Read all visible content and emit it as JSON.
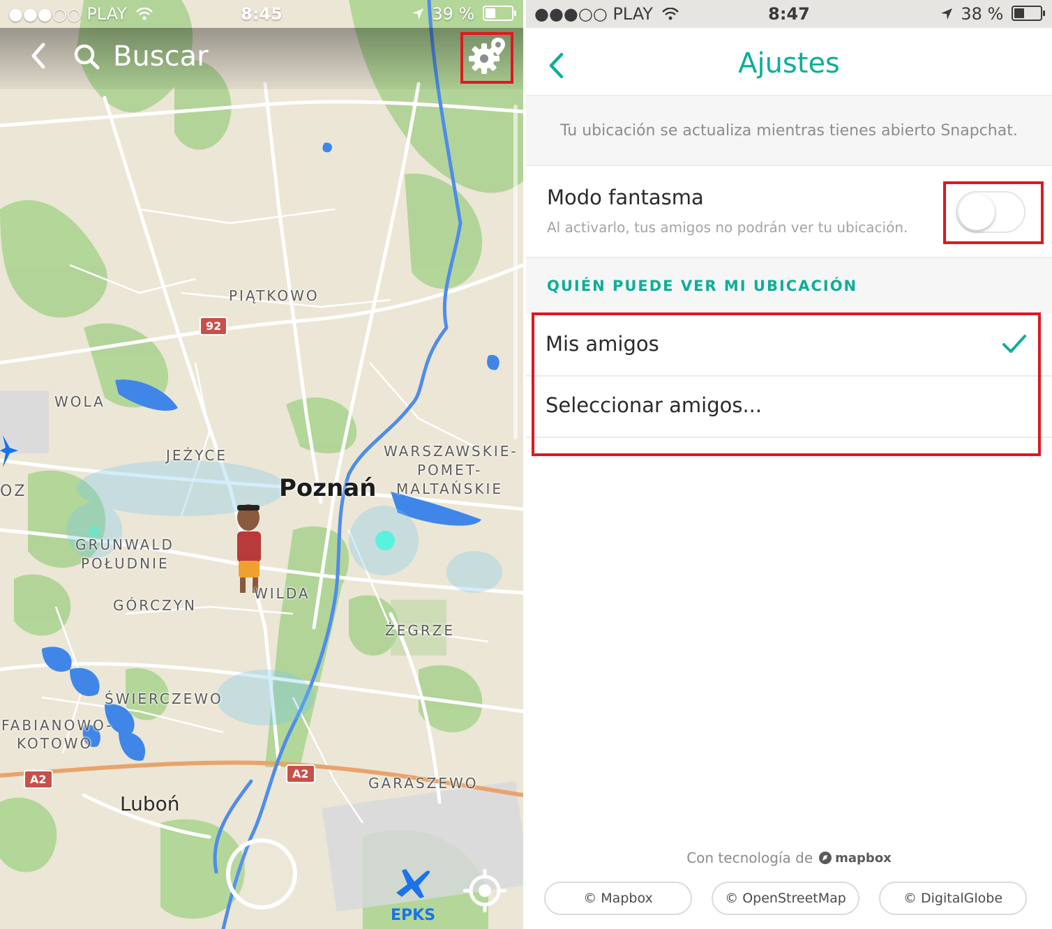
{
  "left_screen": {
    "status_bar": {
      "carrier": "●●●○○ PLAY",
      "time": "8:45",
      "battery": "39 %",
      "battery_level": 0.39
    },
    "search": {
      "label": "Buscar"
    },
    "map": {
      "city": "Poznań",
      "town": "Luboń",
      "districts": [
        "PIĄTKOWO",
        "WOLA",
        "JEŻYCE",
        "WARSZAWSKIE-",
        "POMET-",
        "MALTAŃSKIE",
        "GRUNWALD",
        "POŁUDNIE",
        "GÓRCZYN",
        "WILDA",
        "ŻEGRZE",
        "ŚWIERCZEWO",
        "FABIANOWO-",
        "KOTOWO",
        "GARASZEWO",
        "OZ"
      ],
      "road_shields": [
        "92",
        "A2",
        "A2"
      ],
      "airport": "EPKS"
    },
    "icons": {
      "back": "chevron-left-icon",
      "search": "search-icon",
      "settings": "gear-location-icon",
      "airport": "airplane-icon",
      "locate": "crosshair-icon"
    }
  },
  "right_screen": {
    "status_bar": {
      "carrier": "●●●○○ PLAY",
      "time": "8:47",
      "battery": "38 %",
      "battery_level": 0.38
    },
    "title": "Ajustes",
    "info_text": "Tu ubicación se actualiza mientras tienes abierto Snapchat.",
    "ghost_mode": {
      "title": "Modo fantasma",
      "subtitle": "Al activarlo, tus amigos no podrán ver tu ubicación.",
      "enabled": false
    },
    "section_title": "QUIÉN PUEDE VER MI UBICACIÓN",
    "options": [
      {
        "label": "Mis amigos",
        "selected": true
      },
      {
        "label": "Seleccionar amigos...",
        "selected": false
      }
    ],
    "powered_by": "Con tecnología de",
    "powered_brand": "mapbox",
    "credits": [
      "© Mapbox",
      "© OpenStreetMap",
      "© DigitalGlobe"
    ],
    "accent_color": "#0cae97"
  }
}
